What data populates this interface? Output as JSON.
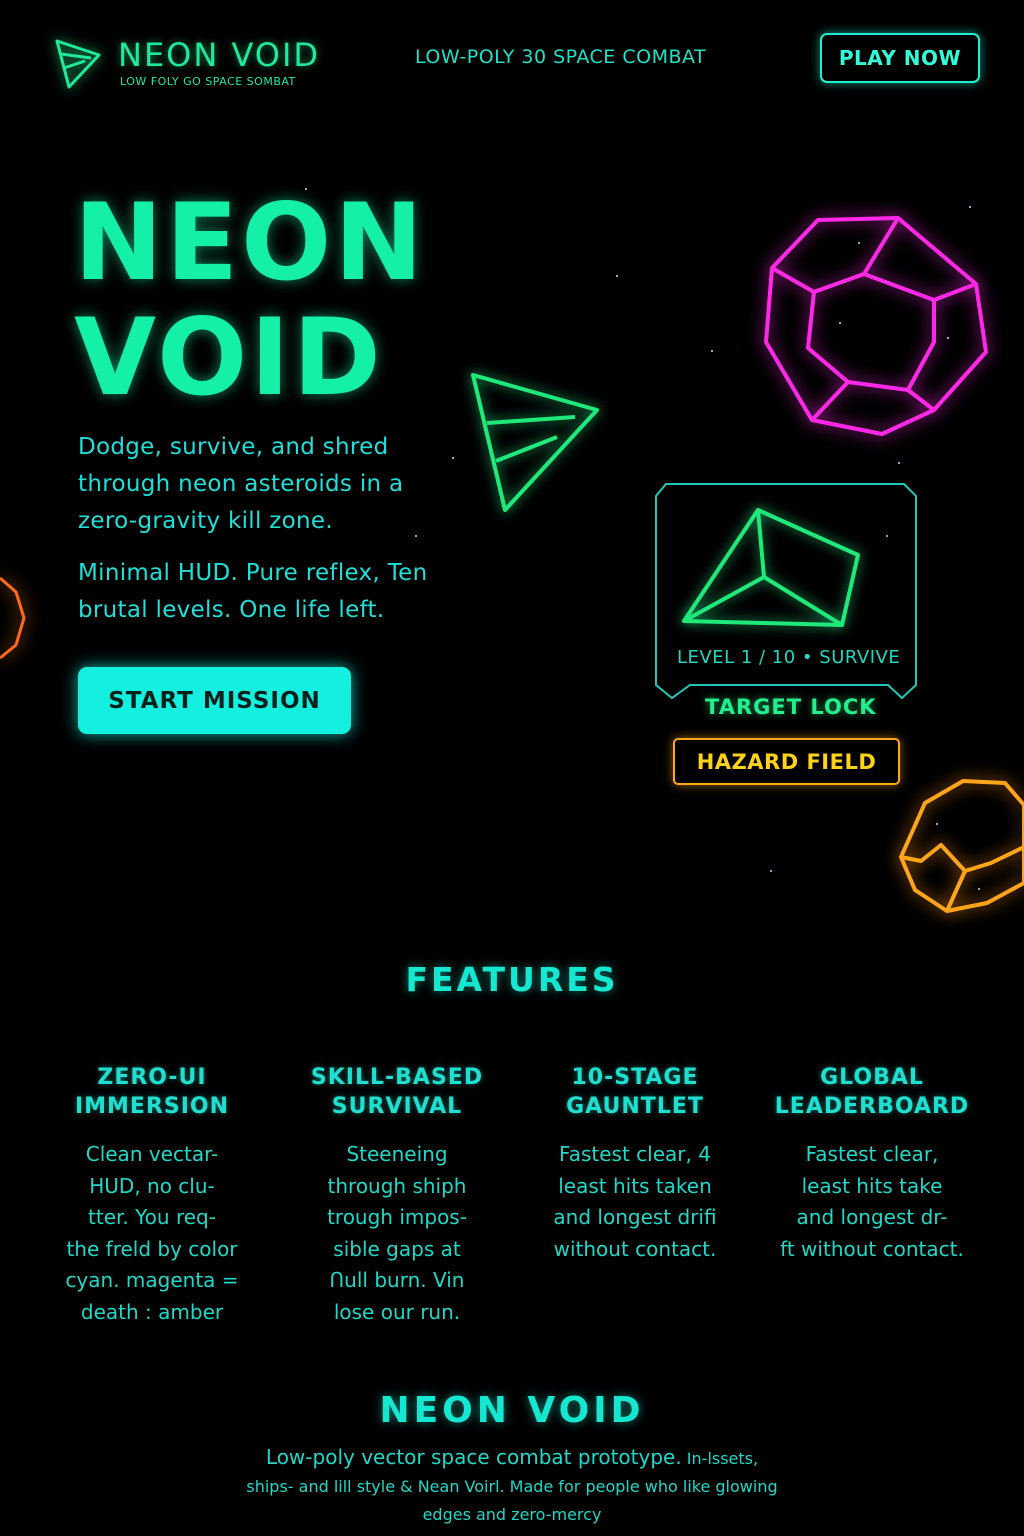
{
  "header": {
    "logo_icon": "paper-plane-ship-icon",
    "brand": "NEON VOID",
    "brand_sub": "LOW FOLY GO SPACE SOMBAT",
    "tagline": "LOW-POLY 30 SPACE COMBAT",
    "play_label": "PLAY NOW"
  },
  "hero": {
    "title_line1": "NEON",
    "title_line2": "VOID",
    "paragraph1": "Dodge, survive, and shred through neon asteroids in a zero-gravity kill zone.",
    "paragraph2": "Minimal HUD. Pure reflex, Ten brutal levels. One life left.",
    "cta_label": "START MISSION"
  },
  "hud": {
    "level_text": "LEVEL 1 / 10 • SURVIVE",
    "target_lock": "TARGET LOCK",
    "hazard": "HAZARD FIELD"
  },
  "features": {
    "title": "FEATURES",
    "items": [
      {
        "title": "ZERO-UI\nIMMERSION",
        "text": "Clean vectar-\nHUD, no clu-\ntter. You req-\nthe freld by color\ncyan. magenta =\ndeath : amber"
      },
      {
        "title": "SKILL-BASED\nSURVIVAL",
        "text": "Steeneing\nthrough shiph\ntrough impos-\nsible gaps at\nՈull burn. Vin\nlose our run."
      },
      {
        "title": "10-STAGE\nGAUNTLET",
        "text": "Fastest clear, 4\nleast hits taken\nand longest drifi\nwithout contact."
      },
      {
        "title": "GLOBAL\nLEADERBOARD",
        "text": "Fastest clear,\nleast hits take\nand longest dr-\nft without contact."
      }
    ]
  },
  "footer": {
    "title": "NEON VOID",
    "desc_main": "Low-poly vector space combat prototype.",
    "desc_small_1": " In-lssets,",
    "desc_small_2": "ships- and lill style & Nean Voirl. Made for people who like glowing edges and zero-mercy"
  },
  "colors": {
    "background": "#000000",
    "primary_cyan": "#14f0e0",
    "green": "#14f0a8",
    "magenta": "#ff28e6",
    "amber": "#ffa51a",
    "orange": "#ff6a1a"
  }
}
